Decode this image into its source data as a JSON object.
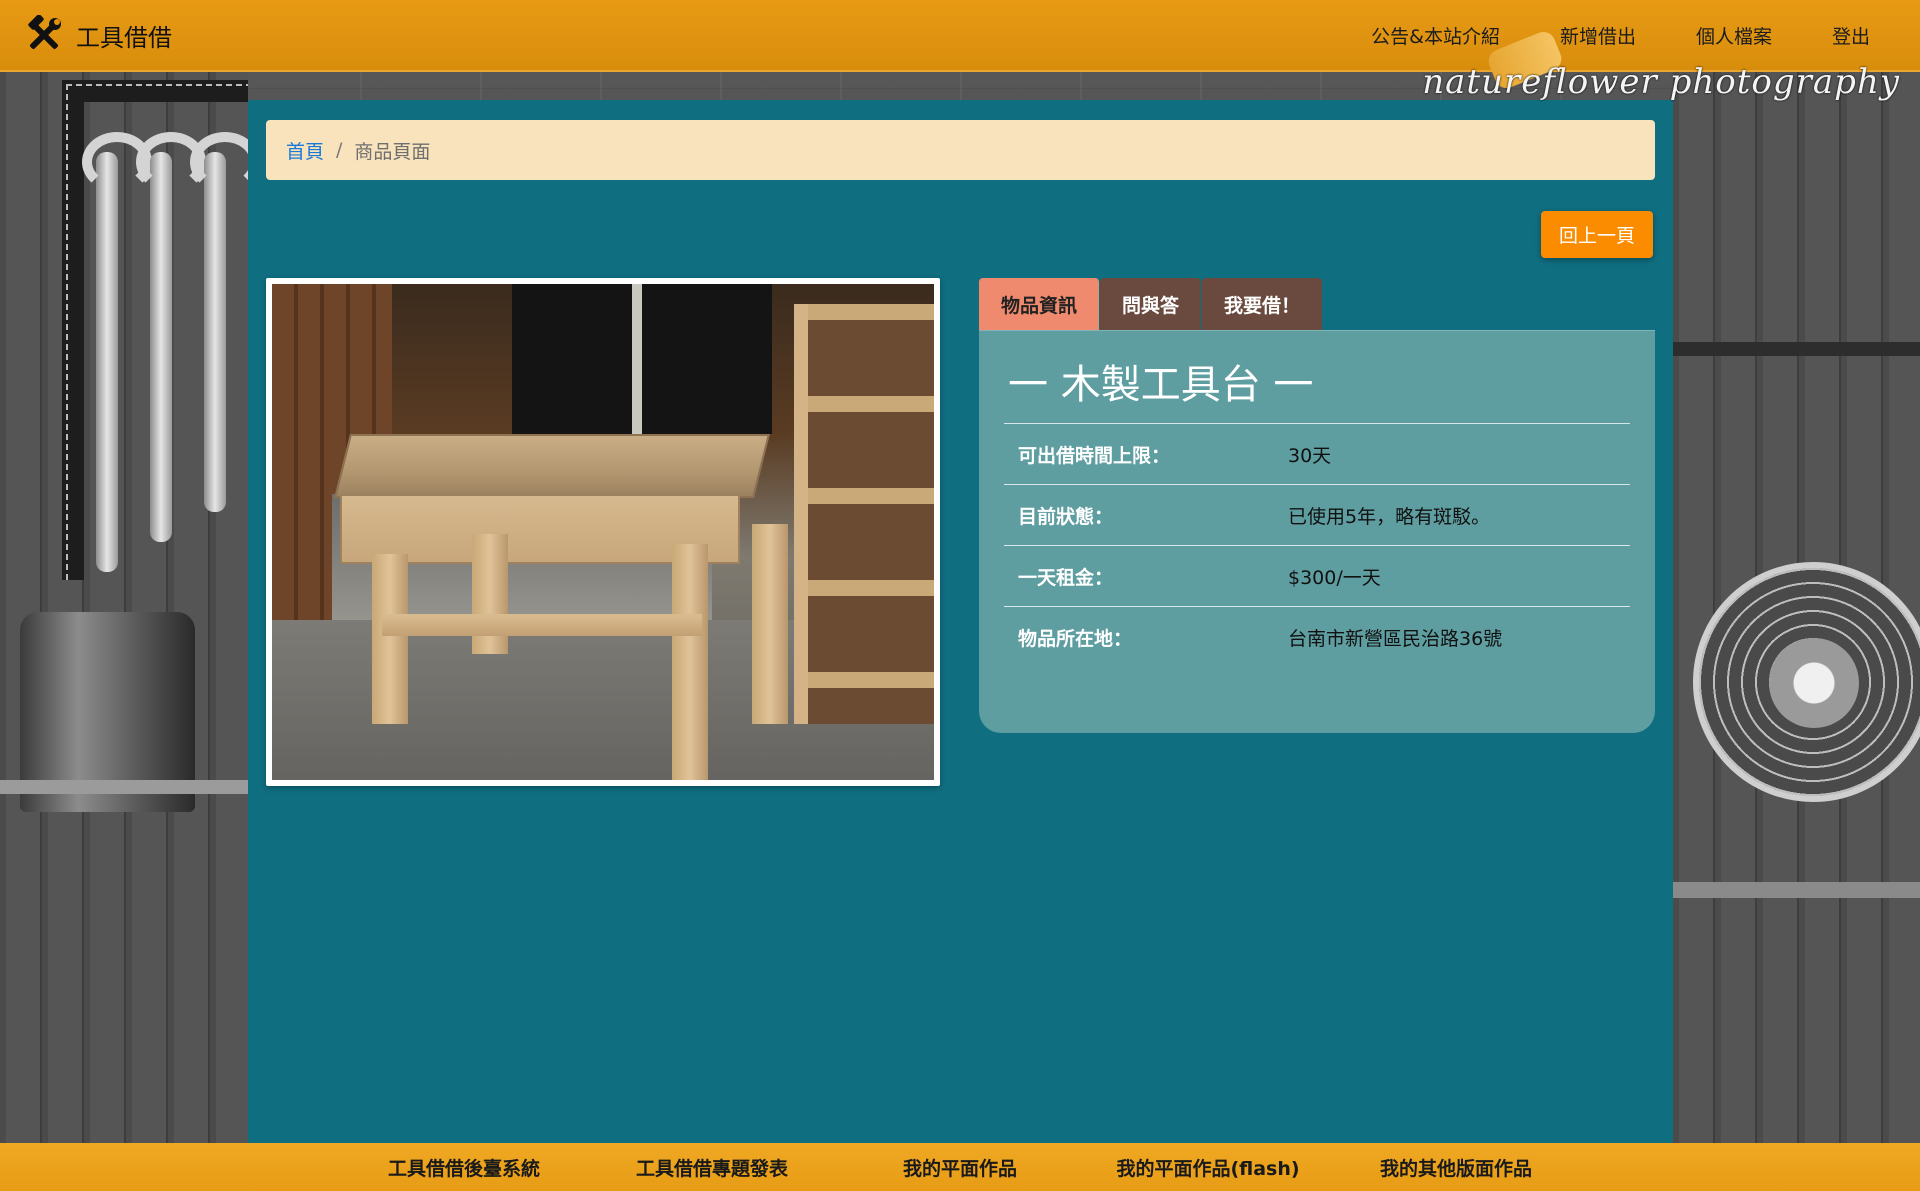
{
  "navbar": {
    "brand": "工具借借",
    "links": [
      "公告&本站介紹",
      "新增借出",
      "個人檔案",
      "登出"
    ]
  },
  "watermark": "natureflower photography",
  "breadcrumb": {
    "home": "首頁",
    "separator": "/",
    "current": "商品頁面"
  },
  "back_button": "回上一頁",
  "tabs": [
    "物品資訊",
    "問與答",
    "我要借！"
  ],
  "item": {
    "title": "一 木製工具台 一",
    "fields": [
      {
        "label": "可出借時間上限：",
        "value": "30天"
      },
      {
        "label": "目前狀態：",
        "value": "已使用5年，略有斑駁。"
      },
      {
        "label": "一天租金：",
        "value": "$300/一天"
      },
      {
        "label": "物品所在地：",
        "value": "台南市新營區民治路36號"
      }
    ]
  },
  "footer": {
    "links": [
      "工具借借後臺系統",
      "工具借借專題發表",
      "我的平面作品",
      "我的平面作品(flash)",
      "我的其他版面作品"
    ]
  },
  "colors": {
    "navbar": "#e0930f",
    "main_bg": "#0f6e80",
    "breadcrumb_bg": "#f8e3bd",
    "back_button": "#fb8c00",
    "tab_active": "#ef8a6e",
    "tab_inactive": "#6a4a3e",
    "info_panel": "#5e9da0",
    "footer": "#ec9f18"
  },
  "icons": {
    "brand": "hammer-wrench-icon"
  }
}
